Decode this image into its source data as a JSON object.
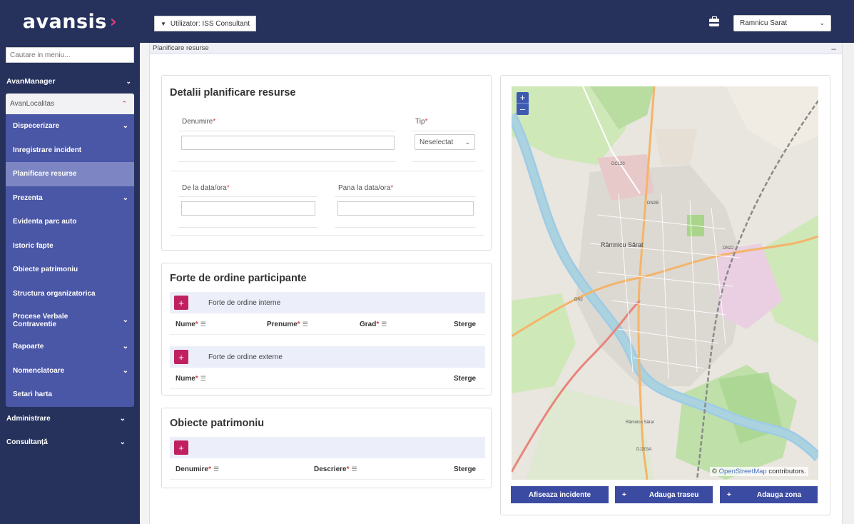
{
  "app": {
    "logo": "avansis",
    "logo_mark": "›"
  },
  "topbar": {
    "user_label": "Utilizator: ISS Consultant",
    "city": "Ramnicu Sarat"
  },
  "sidebar": {
    "search_placeholder": "Cautare in meniu...",
    "items": [
      {
        "label": "AvanManager"
      },
      {
        "label": "AvanLocalitas"
      }
    ],
    "submenu": [
      {
        "label": "Dispecerizare",
        "arrow": true
      },
      {
        "label": "Inregistrare incident",
        "arrow": false
      },
      {
        "label": "Planificare resurse",
        "arrow": false,
        "active": true
      },
      {
        "label": "Prezenta",
        "arrow": true
      },
      {
        "label": "Evidenta parc auto",
        "arrow": false
      },
      {
        "label": "Istoric fapte",
        "arrow": false
      },
      {
        "label": "Obiecte patrimoniu",
        "arrow": false
      },
      {
        "label": "Structura organizatorica",
        "arrow": false
      },
      {
        "label": "Procese Verbale Contraventie",
        "arrow": true
      },
      {
        "label": "Rapoarte",
        "arrow": true
      },
      {
        "label": "Nomenclatoare",
        "arrow": true
      },
      {
        "label": "Setari harta",
        "arrow": false
      }
    ],
    "bottom_items": [
      {
        "label": "Administrare"
      },
      {
        "label": "Consultanță"
      }
    ]
  },
  "breadcrumb": "Planificare resurse",
  "details": {
    "title": "Detalii planificare resurse",
    "name_label": "Denumire",
    "type_label": "Tip",
    "type_value": "Neselectat",
    "from_label": "De la data/ora",
    "to_label": "Pana la data/ora"
  },
  "forces": {
    "title": "Forte de ordine participante",
    "internal_label": "Forte de ordine interne",
    "external_label": "Forte de ordine externe",
    "col_nume": "Nume",
    "col_prenume": "Prenume",
    "col_grad": "Grad",
    "col_sterge": "Sterge"
  },
  "patrimony": {
    "title": "Obiecte patrimoniu",
    "col_denumire": "Denumire",
    "col_descriere": "Descriere",
    "col_sterge": "Sterge"
  },
  "map": {
    "city_label": "Râmnicu Sărat",
    "road_labels": [
      "DC120",
      "DN2",
      "DN2B",
      "DN22",
      "DJ203A",
      "Rămnicu Sărat"
    ],
    "attribution_prefix": "© ",
    "attribution_link": "OpenStreetMap",
    "attribution_suffix": " contributors.",
    "btn_incidents": "Afiseaza incidente",
    "btn_route": "Adauga traseu",
    "btn_zone": "Adauga zona"
  },
  "colors": {
    "nav_bg": "#26325c",
    "accent": "#c0205f",
    "button": "#3c4ba2"
  }
}
